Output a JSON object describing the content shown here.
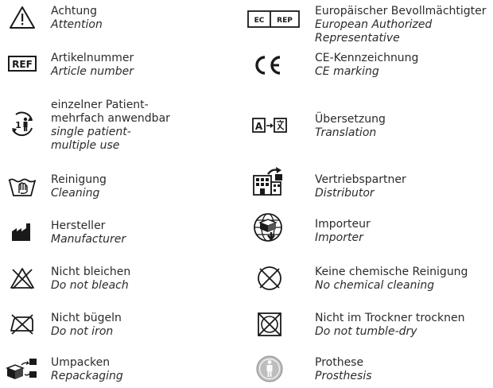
{
  "left_column": [
    {
      "icon": "warning-triangle-icon",
      "de": "Achtung",
      "en": "Attention"
    },
    {
      "icon": "ref-icon",
      "icon_text": "REF",
      "de": "Artikelnummer",
      "en": "Article number"
    },
    {
      "icon": "single-patient-multiple-use-icon",
      "icon_text": "1",
      "de": "einzelner Patient-\nmehrfach anwendbar",
      "en": "single patient-\nmultiple use"
    },
    {
      "icon": "cleaning-basin-icon",
      "de": "Reinigung",
      "en": "Cleaning"
    },
    {
      "icon": "manufacturer-factory-icon",
      "de": "Hersteller",
      "en": "Manufacturer"
    },
    {
      "icon": "do-not-bleach-icon",
      "de": "Nicht bleichen",
      "en": "Do not bleach"
    },
    {
      "icon": "do-not-iron-icon",
      "de": "Nicht bügeln",
      "en": "Do not iron"
    },
    {
      "icon": "repackaging-icon",
      "de": "Umpacken",
      "en": "Repackaging"
    }
  ],
  "right_column": [
    {
      "icon": "ec-rep-icon",
      "icon_text_a": "EC",
      "icon_text_b": "REP",
      "de": "Europäischer Bevollmächtigter",
      "en": "European Authorized Representative"
    },
    {
      "icon": "ce-marking-icon",
      "de": "CE-Kennzeichnung",
      "en": "CE marking"
    },
    {
      "icon": "translation-icon",
      "icon_text": "A",
      "de": "Übersetzung",
      "en": "Translation"
    },
    {
      "icon": "distributor-icon",
      "de": "Vertriebspartner",
      "en": "Distributor"
    },
    {
      "icon": "importer-globe-icon",
      "de": "Importeur",
      "en": "Importer"
    },
    {
      "icon": "no-chemical-cleaning-icon",
      "de": "Keine chemische Reinigung",
      "en": "No chemical cleaning"
    },
    {
      "icon": "do-not-tumble-dry-icon",
      "de": "Nicht im Trockner trocknen",
      "en": "Do not tumble-dry"
    },
    {
      "icon": "prosthesis-icon",
      "de": "Prothese",
      "en": "Prosthesis"
    }
  ],
  "colors": {
    "text": "#2b2b2b",
    "icon": "#1a1a1a",
    "prosthesis_fill": "#bdbdbd"
  }
}
